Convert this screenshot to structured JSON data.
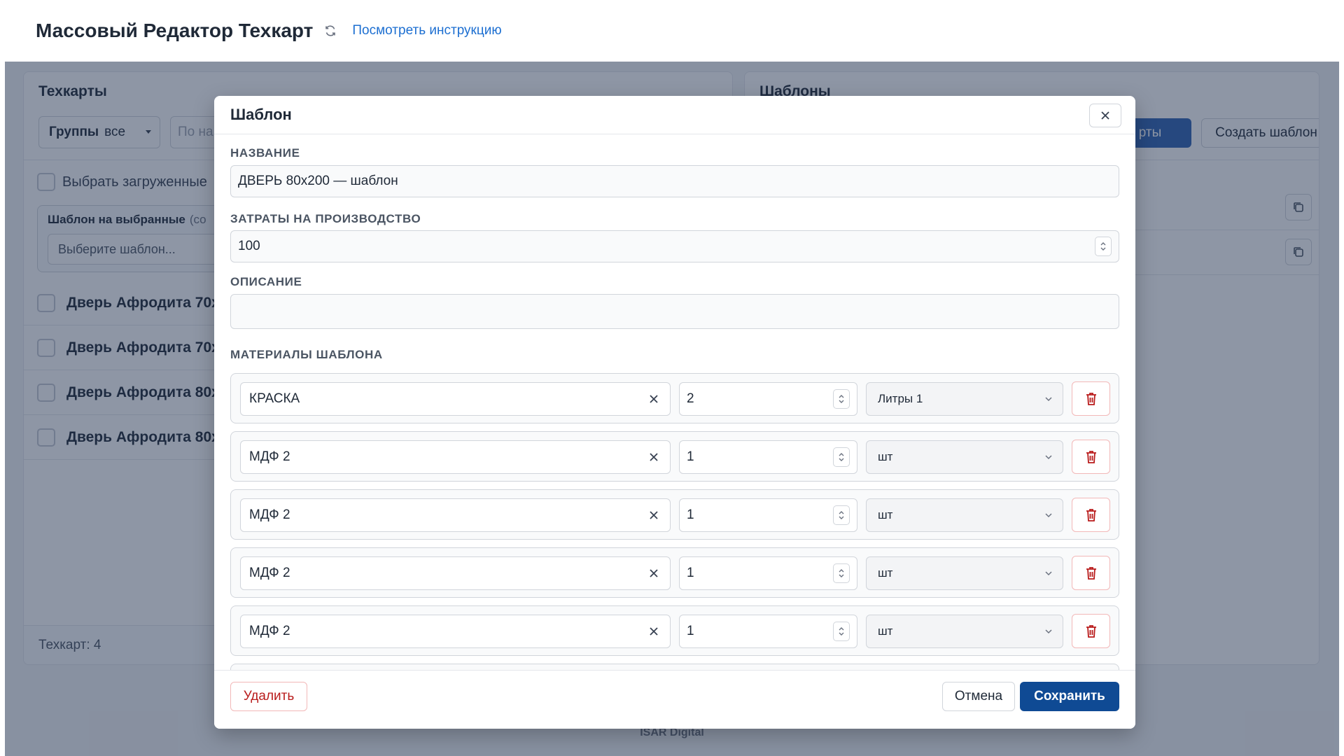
{
  "header": {
    "title": "Массовый Редактор Техкарт",
    "help_link": "Посмотреть инструкцию"
  },
  "left_panel": {
    "title": "Техкарты",
    "groups_label": "Группы",
    "groups_value": "все",
    "search_placeholder": "По на",
    "select_loaded": "Выбрать загруженные",
    "template_on_selected_label": "Шаблон на выбранные",
    "template_on_selected_note": "(со",
    "template_select_placeholder": "Выберите шаблон...",
    "cards": [
      {
        "name": "Дверь Афродита 70х"
      },
      {
        "name": "Дверь Афродита 70х"
      },
      {
        "name": "Дверь Афродита 80х"
      },
      {
        "name": "Дверь Афродита 80х"
      }
    ],
    "count_text": "Техкарт: 4"
  },
  "right_panel": {
    "title": "Шаблоны",
    "apply_button": "рты",
    "create_button": "Создать шаблон"
  },
  "footer": {
    "brand": "ISAR Digital"
  },
  "modal": {
    "title": "Шаблон",
    "name_label": "Название",
    "name_value": "ДВЕРЬ 80x200 — шаблон",
    "cost_label": "Затраты на производство",
    "cost_value": "100",
    "description_label": "Описание",
    "description_value": "",
    "materials_label": "Материалы шаблона",
    "materials": [
      {
        "name": "КРАСКА",
        "qty": "2",
        "unit": "Литры 1"
      },
      {
        "name": "МДФ 2",
        "qty": "1",
        "unit": "шт"
      },
      {
        "name": "МДФ 2",
        "qty": "1",
        "unit": "шт"
      },
      {
        "name": "МДФ 2",
        "qty": "1",
        "unit": "шт"
      },
      {
        "name": "МДФ 2",
        "qty": "1",
        "unit": "шт"
      }
    ],
    "delete_button": "Удалить",
    "cancel_button": "Отмена",
    "save_button": "Сохранить"
  },
  "colors": {
    "primary": "#0f4a94",
    "link": "#1d6fd1",
    "danger": "#b91c1c",
    "overlay": "#1e2d4b"
  }
}
